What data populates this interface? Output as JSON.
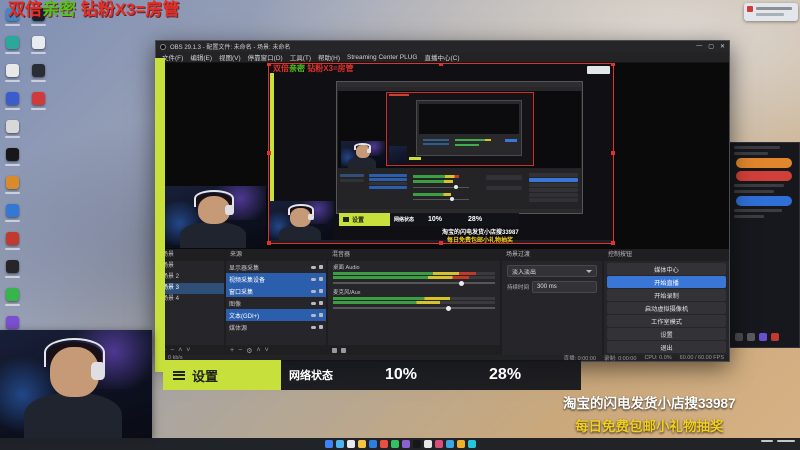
{
  "banner": {
    "part1": "双倍",
    "part2": "亲密",
    "part3": " 钻粉X3=房管"
  },
  "overlay": {
    "settings_icon": "hamburger-menu",
    "settings_label": "设置",
    "network_label": "网络状态",
    "stat1": "10%",
    "stat2": "28%",
    "ad_line1": "淘宝的闪电发货小店搜33987",
    "ad_line2": "每日免费包邮小礼物抽奖"
  },
  "obs": {
    "title": "OBS 29.1.3 - 配置文件: 未命名 - 场景: 未命名",
    "menu": [
      "文件(F)",
      "编辑(E)",
      "视图(V)",
      "停靠窗口(D)",
      "工具(T)",
      "帮助(H)",
      "Streaming Center PLUG",
      "直播中心(C)"
    ],
    "window_buttons": {
      "minimize": "—",
      "maximize": "▢",
      "close": "✕"
    },
    "docks": {
      "scenes": {
        "title": "场景",
        "items": [
          "场景",
          "场景 2",
          "场景 3",
          "场景 4"
        ]
      },
      "sources": {
        "title": "来源",
        "items": [
          {
            "label": "显示器采集",
            "selected": false
          },
          {
            "label": "视频采集设备",
            "selected": true
          },
          {
            "label": "窗口采集",
            "selected": true
          },
          {
            "label": "图像",
            "selected": false
          },
          {
            "label": "文本(GDI+)",
            "selected": true
          },
          {
            "label": "媒体源",
            "selected": false
          }
        ]
      },
      "mixer": {
        "title": "混音器",
        "tracks": [
          {
            "name": "桌面 Audio"
          },
          {
            "name": "麦克风/Aux"
          }
        ]
      },
      "transitions": {
        "title": "场景过渡",
        "selected": "淡入淡出",
        "duration_label": "持续时间",
        "duration": "300 ms"
      },
      "controls": {
        "title": "控制按钮",
        "buttons": [
          "媒体中心",
          "开始直播",
          "开始录制",
          "启动虚拟摄像机",
          "工作室模式",
          "设置",
          "退出"
        ],
        "primary_index": 1
      }
    },
    "status": {
      "bitrate": "0 kb/s",
      "live": "直播: 0:00:00",
      "rec": "录制: 0:00:00",
      "cpu": "CPU: 0.0%",
      "fps": "60.00 / 60.00 FPS"
    }
  },
  "colors": {
    "accent_green": "#c8e03c",
    "selection_red": "#e0312e",
    "primary_blue": "#3a76d6"
  },
  "desktop_icons": {
    "colors": [
      "#3f88c5",
      "#2aa89a",
      "#e8e8e8",
      "#3b5ccc",
      "#d8d8d8",
      "#17171a",
      "#d98a2b",
      "#3478d6",
      "#c23a2f",
      "#26262a",
      "#35b54a",
      "#7a4fd0",
      "#16202d",
      "#e8ecef",
      "#2a2d34",
      "#d13a3a"
    ]
  },
  "taskbar": {
    "icon_colors": [
      "#4cb4f0",
      "#e8eaed",
      "#f6c344",
      "#2f7fe0",
      "#e94f3f",
      "#33c162",
      "#8a63d2",
      "#15171b",
      "#e8e8e8",
      "#d94f7a",
      "#3ba6e0",
      "#f0b02e",
      "#26c6da"
    ]
  }
}
